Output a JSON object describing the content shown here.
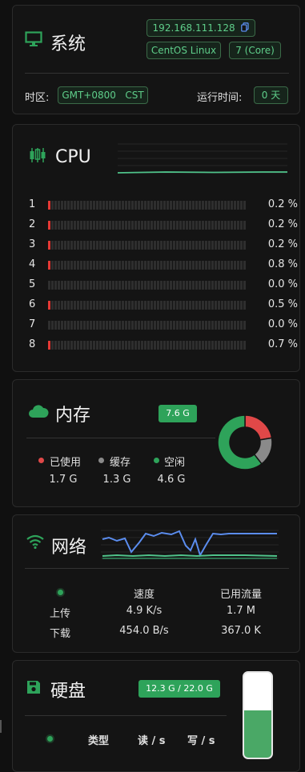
{
  "system": {
    "title": "系统",
    "ip": "192.168.111.128",
    "os": "CentOS Linux",
    "version": "7 (Core)",
    "timezone_label": "时区:",
    "timezone": "GMT+0800   CST",
    "uptime_label": "运行时间:",
    "uptime": "0 天"
  },
  "cpu": {
    "title": "CPU",
    "cores": [
      {
        "id": "1",
        "pct": "0.2 %",
        "value": 0.2
      },
      {
        "id": "2",
        "pct": "0.2 %",
        "value": 0.2
      },
      {
        "id": "3",
        "pct": "0.2 %",
        "value": 0.2
      },
      {
        "id": "4",
        "pct": "0.8 %",
        "value": 0.8
      },
      {
        "id": "5",
        "pct": "0.0 %",
        "value": 0.0
      },
      {
        "id": "6",
        "pct": "0.5 %",
        "value": 0.5
      },
      {
        "id": "7",
        "pct": "0.0 %",
        "value": 0.0
      },
      {
        "id": "8",
        "pct": "0.7 %",
        "value": 0.7
      }
    ]
  },
  "memory": {
    "title": "内存",
    "total": "7.6 G",
    "used_label": "已使用",
    "used": "1.7 G",
    "cache_label": "缓存",
    "cache": "1.3 G",
    "free_label": "空闲",
    "free": "4.6 G",
    "colors": {
      "used": "#e04848",
      "cache": "#8a8a8a",
      "free": "#2ea35a"
    }
  },
  "network": {
    "title": "网络",
    "speed_header": "速度",
    "traffic_header": "已用流量",
    "upload_label": "上传",
    "upload_speed": "4.9 K/s",
    "upload_total": "1.7 M",
    "download_label": "下载",
    "download_speed": "454.0 B/s",
    "download_total": "367.0 K"
  },
  "disk": {
    "title": "硬盘",
    "usage": "12.3 G / 22.0 G",
    "fill_fraction": 0.56,
    "type_header": "类型",
    "read_header": "读 / s",
    "write_header": "写 / s"
  },
  "colors": {
    "accent": "#2ea35a",
    "alert": "#e53935",
    "net_up": "#5b8def"
  }
}
